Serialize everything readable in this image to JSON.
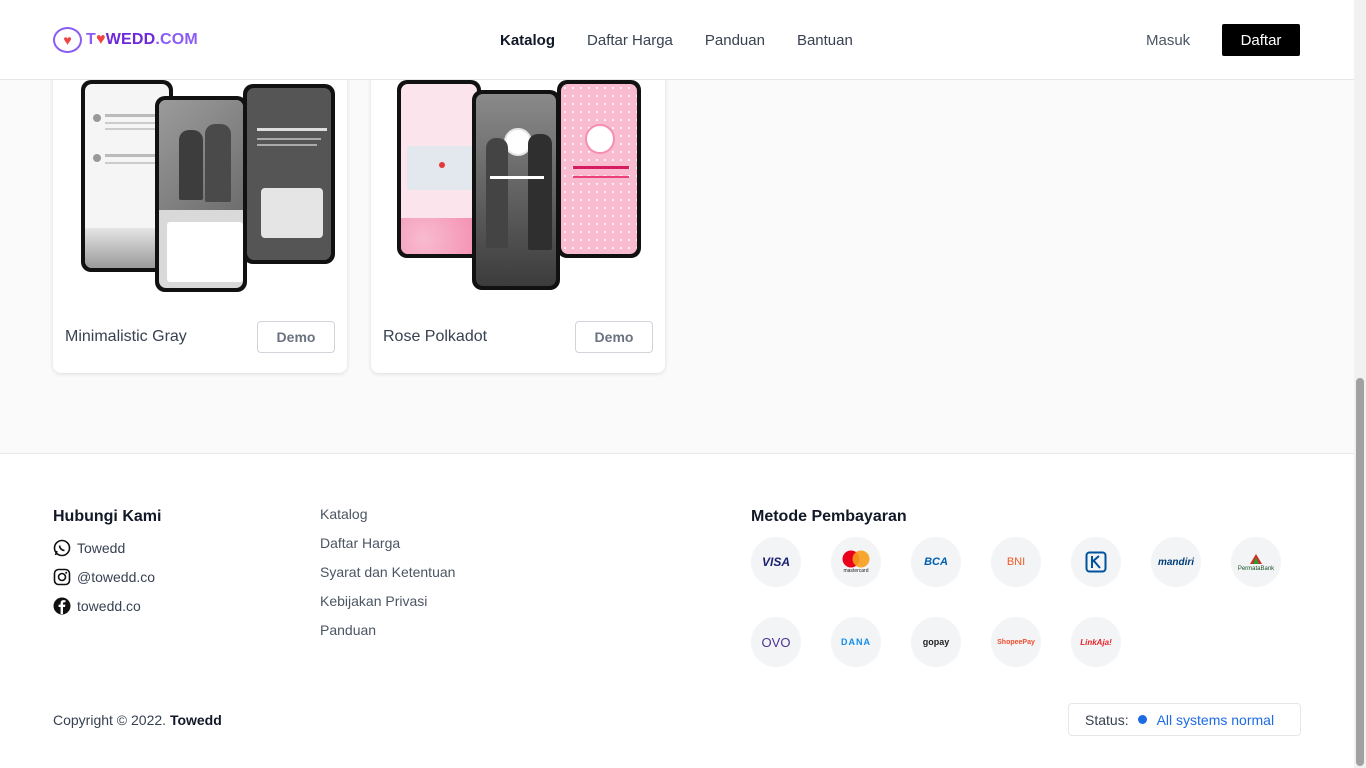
{
  "header": {
    "logo": {
      "prefix": "T",
      "heart": "♥",
      "rest": "WEDD",
      "suffix": ".COM"
    },
    "nav": [
      {
        "label": "Katalog",
        "active": true
      },
      {
        "label": "Daftar Harga",
        "active": false
      },
      {
        "label": "Panduan",
        "active": false
      },
      {
        "label": "Bantuan",
        "active": false
      }
    ],
    "login_label": "Masuk",
    "register_label": "Daftar"
  },
  "catalog": {
    "cards": [
      {
        "title": "Minimalistic Gray",
        "demo_label": "Demo"
      },
      {
        "title": "Rose Polkadot",
        "demo_label": "Demo"
      }
    ]
  },
  "footer": {
    "contact_heading": "Hubungi Kami",
    "contacts": [
      {
        "icon": "whatsapp-icon",
        "label": "Towedd"
      },
      {
        "icon": "instagram-icon",
        "label": "@towedd.co"
      },
      {
        "icon": "facebook-icon",
        "label": "towedd.co"
      }
    ],
    "links": [
      "Katalog",
      "Daftar Harga",
      "Syarat dan Ketentuan",
      "Kebijakan Privasi",
      "Panduan"
    ],
    "payment_heading": "Metode Pembayaran",
    "payments": [
      {
        "label": "VISA",
        "color": "#1a1f71"
      },
      {
        "label": "mastercard",
        "color": "#222222"
      },
      {
        "label": "BCA",
        "color": "#0060af"
      },
      {
        "label": "BNI",
        "color": "#f15a22"
      },
      {
        "label": "BRI",
        "color": "#00529c"
      },
      {
        "label": "mandiri",
        "color": "#003d79"
      },
      {
        "label": "PermataBank",
        "color": "#1e5128"
      },
      {
        "label": "OVO",
        "color": "#4c3494"
      },
      {
        "label": "DANA",
        "color": "#118eea"
      },
      {
        "label": "gopay",
        "color": "#00aed6"
      },
      {
        "label": "ShopeePay",
        "color": "#ee4d2d"
      },
      {
        "label": "LinkAja!",
        "color": "#e82529"
      }
    ],
    "copyright_prefix": "Copyright © 2022.",
    "copyright_brand": "Towedd",
    "status_label": "Status:",
    "status_value": "All systems normal"
  }
}
